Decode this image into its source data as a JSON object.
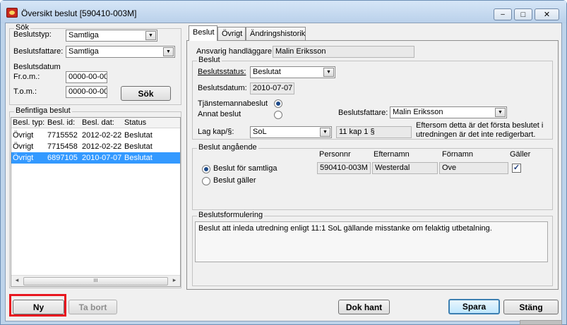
{
  "window": {
    "title": "Översikt beslut  [590410-003M]",
    "min": "–",
    "max": "□",
    "close": "✕"
  },
  "search": {
    "legend": "Sök",
    "beslutstyp_label": "Beslutstyp:",
    "beslutstyp_value": "Samtliga",
    "beslutsfattare_label": "Beslutsfattare:",
    "beslutsfattare_value": "Samtliga",
    "beslutsdatum_label": "Beslutsdatum",
    "from_label": "Fr.o.m.:",
    "from_value": "0000-00-00",
    "tom_label": "T.o.m.:",
    "tom_value": "0000-00-00",
    "search_button": "Sök"
  },
  "existing": {
    "legend": "Befintliga beslut",
    "columns": [
      "Besl. typ:",
      "Besl. id:",
      "Besl. dat:",
      "Status"
    ],
    "rows": [
      [
        "Övrigt",
        "7715552",
        "2012-02-22",
        "Beslutat"
      ],
      [
        "Övrigt",
        "7715458",
        "2012-02-22",
        "Beslutat"
      ],
      [
        "Övrigt",
        "6897105",
        "2010-07-07",
        "Beslutat"
      ]
    ],
    "selected_row": 2
  },
  "tabs": [
    "Beslut",
    "Övrigt",
    "Ändringshistorik"
  ],
  "decision": {
    "handlaggare_label": "Ansvarig handläggare:",
    "handlaggare_value": "Malin Eriksson",
    "legend": "Beslut",
    "status_label": "Beslutsstatus:",
    "status_value": "Beslutat",
    "datum_label": "Beslutsdatum:",
    "datum_value": "2010-07-07",
    "tjansteman_label": "Tjänstemannabeslut",
    "annat_label": "Annat beslut",
    "fattare_label": "Beslutsfattare:",
    "fattare_value": "Malin Eriksson",
    "lag_label": "Lag kap/§:",
    "lag_value": "SoL",
    "paragraf_value": "11 kap 1 §",
    "note": "Eftersom detta är det första beslutet i utredningen är det inte redigerbart."
  },
  "regarding": {
    "legend": "Beslut angående",
    "col_personnr": "Personnr",
    "col_efternamn": "Efternamn",
    "col_fornamn": "Förnamn",
    "col_galler": "Gäller",
    "personnr": "590410-003M",
    "efternamn": "Westerdal",
    "fornamn": "Ove",
    "radio_all": "Beslut för samtliga",
    "radio_galler": "Beslut gäller"
  },
  "formulering": {
    "legend": "Beslutsformulering",
    "text": "Beslut att inleda utredning enligt 11:1 SoL gällande misstanke om felaktig utbetalning."
  },
  "buttons": {
    "ny": "Ny",
    "ta_bort": "Ta bort",
    "dok_hant": "Dok hant",
    "spara": "Spara",
    "stang": "Stäng"
  },
  "scroll": {
    "left": "◂",
    "right": "▸",
    "grip": "III"
  },
  "colors": {
    "highlight": "#3399ff",
    "red_frame": "#e8161f"
  }
}
